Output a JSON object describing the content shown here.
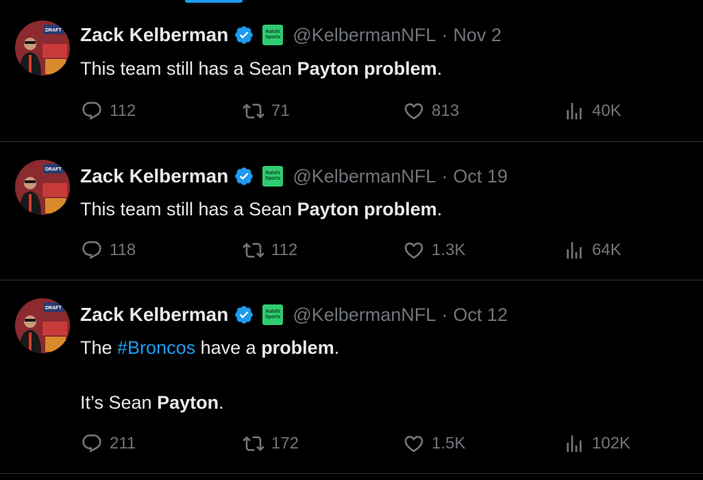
{
  "colors": {
    "background": "#000000",
    "text": "#e7e9ea",
    "secondary": "#71767b",
    "accent": "#1d9bf0",
    "divider": "#2f3336",
    "affiliate_badge": "#2ecc71"
  },
  "icons": {
    "reply": "reply-icon",
    "retweet": "retweet-icon",
    "like": "like-icon",
    "views": "views-icon",
    "verified": "verified-badge-icon"
  },
  "tweets": [
    {
      "name": "Zack Kelberman",
      "handle": "@KelbermanNFL",
      "separator": "·",
      "date": "Nov 2",
      "badge_line1": "Kalshi",
      "badge_line2": "Sports",
      "text_parts": [
        "This team still has a Sean ",
        "Payton problem",
        "."
      ],
      "replies": "112",
      "retweets": "71",
      "likes": "813",
      "views": "40K"
    },
    {
      "name": "Zack Kelberman",
      "handle": "@KelbermanNFL",
      "separator": "·",
      "date": "Oct 19",
      "badge_line1": "Kalshi",
      "badge_line2": "Sports",
      "text_parts": [
        "This team still has a Sean ",
        "Payton problem",
        "."
      ],
      "replies": "118",
      "retweets": "112",
      "likes": "1.3K",
      "views": "64K"
    },
    {
      "name": "Zack Kelberman",
      "handle": "@KelbermanNFL",
      "separator": "·",
      "date": "Oct 12",
      "badge_line1": "Kalshi",
      "badge_line2": "Sports",
      "text_parts": [
        "The ",
        "#Broncos",
        " have a ",
        "problem",
        ".",
        "It’s Sean ",
        "Payton",
        "."
      ],
      "replies": "211",
      "retweets": "172",
      "likes": "1.5K",
      "views": "102K"
    }
  ]
}
